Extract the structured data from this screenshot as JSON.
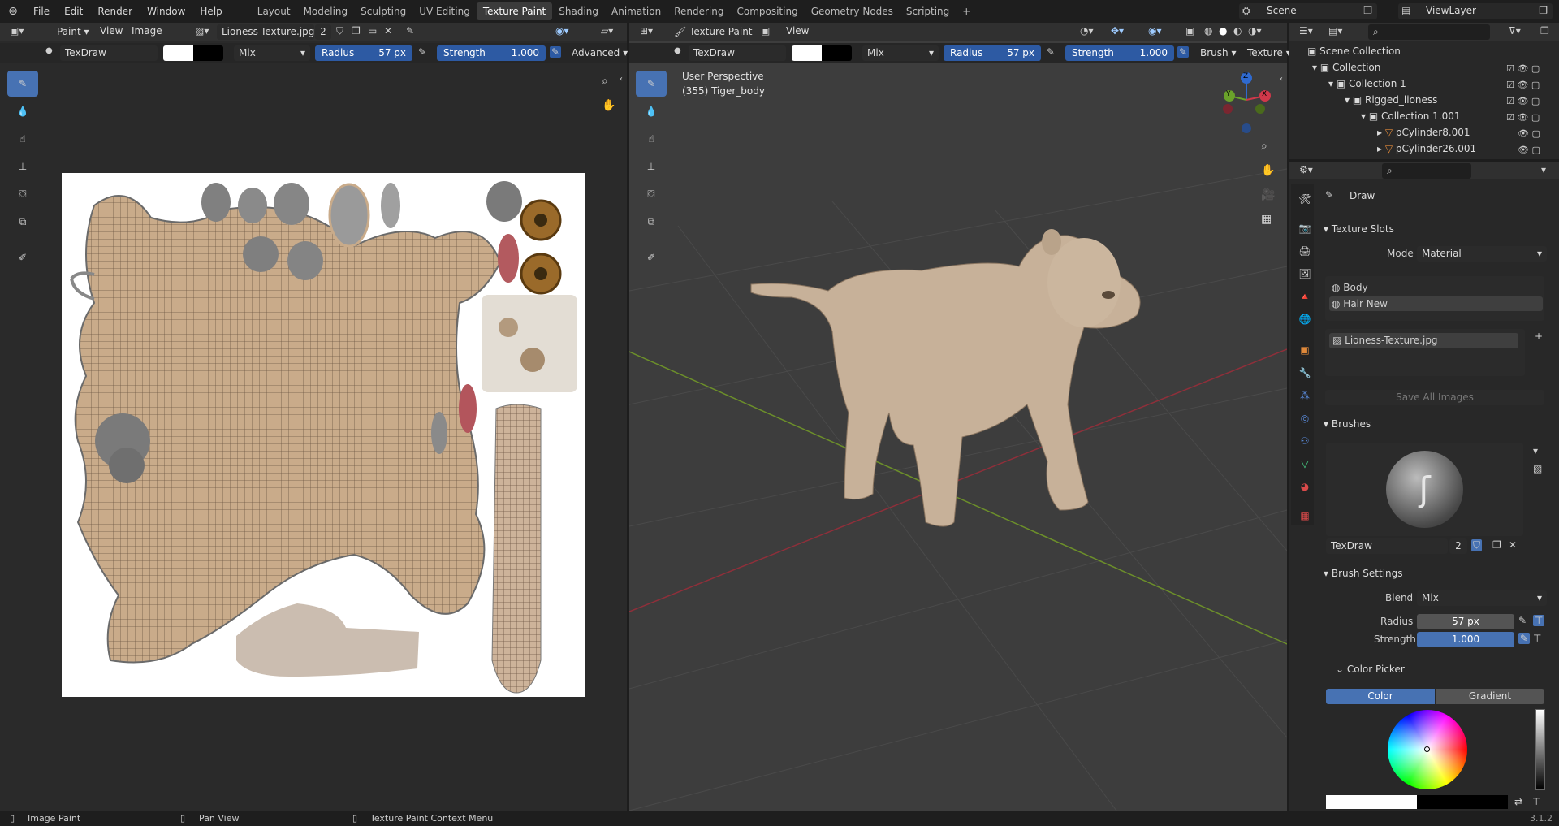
{
  "menu": {
    "file": "File",
    "edit": "Edit",
    "render": "Render",
    "window": "Window",
    "help": "Help"
  },
  "workspaces": [
    "Layout",
    "Modeling",
    "Sculpting",
    "UV Editing",
    "Texture Paint",
    "Shading",
    "Animation",
    "Rendering",
    "Compositing",
    "Geometry Nodes",
    "Scripting"
  ],
  "active_workspace": "Texture Paint",
  "scene": {
    "label": "Scene",
    "viewlayer": "ViewLayer"
  },
  "image_editor": {
    "mode": "Paint",
    "view": "View",
    "image_menu": "Image",
    "image_name": "Lioness-Texture.jpg",
    "users": "2",
    "brush_name": "TexDraw",
    "blend": "Mix",
    "radius_label": "Radius",
    "radius_value": "57 px",
    "strength_label": "Strength",
    "strength_value": "1.000",
    "advanced": "Advanced"
  },
  "viewport": {
    "mode": "Texture Paint",
    "view": "View",
    "brush_name": "TexDraw",
    "blend": "Mix",
    "radius_label": "Radius",
    "radius_value": "57 px",
    "strength_label": "Strength",
    "strength_value": "1.000",
    "brush_menu": "Brush",
    "texture_menu": "Texture",
    "perspective": "User Perspective",
    "object_info": "(355) Tiger_body",
    "gizmo": {
      "x": "X",
      "y": "Y",
      "z": "Z"
    }
  },
  "outliner": {
    "rows": [
      {
        "label": "Scene Collection",
        "depth": 0
      },
      {
        "label": "Collection",
        "depth": 1
      },
      {
        "label": "Collection 1",
        "depth": 2
      },
      {
        "label": "Rigged_lioness",
        "depth": 3
      },
      {
        "label": "Collection 1.001",
        "depth": 4
      },
      {
        "label": "pCylinder8.001",
        "depth": 5
      },
      {
        "label": "pCylinder26.001",
        "depth": 5
      }
    ]
  },
  "properties": {
    "tool": "Draw",
    "texture_slots": {
      "title": "Texture Slots",
      "mode_label": "Mode",
      "mode_value": "Material",
      "slots": [
        "Body",
        "Hair New"
      ],
      "image": "Lioness-Texture.jpg",
      "save_all": "Save All Images"
    },
    "brushes": {
      "title": "Brushes",
      "brush_name": "TexDraw",
      "users": "2"
    },
    "brush_settings": {
      "title": "Brush Settings",
      "blend_label": "Blend",
      "blend_value": "Mix",
      "radius_label": "Radius",
      "radius_value": "57 px",
      "strength_label": "Strength",
      "strength_value": "1.000"
    },
    "color_picker": {
      "title": "Color Picker",
      "tab_color": "Color",
      "tab_gradient": "Gradient"
    }
  },
  "statusbar": {
    "left": "Image Paint",
    "middle": "Pan View",
    "right": "Texture Paint Context Menu",
    "version": "3.1.2"
  },
  "colors": {
    "accent": "#4772b3",
    "slider": "#2d5aa3",
    "bg": "#303030",
    "grid_red": "#8f2f3a",
    "grid_green": "#6c8f2a"
  }
}
